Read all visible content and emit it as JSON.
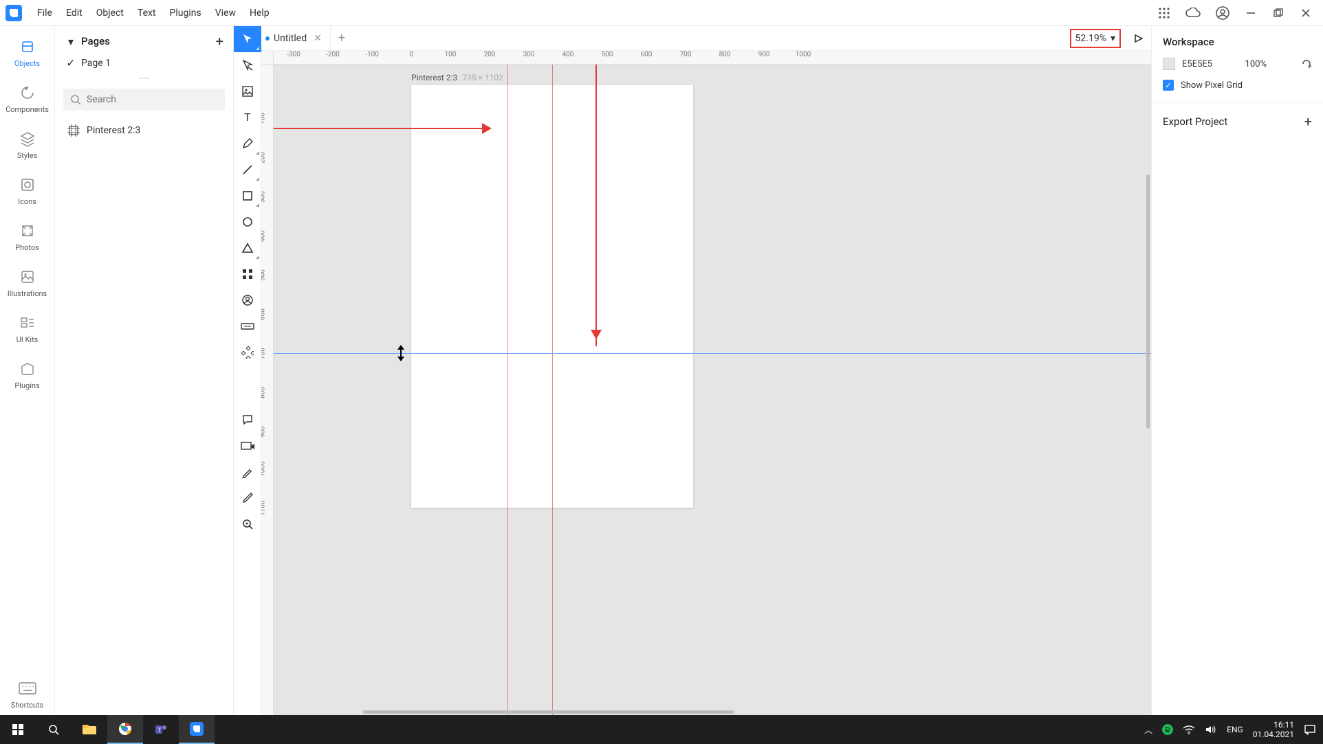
{
  "menu": {
    "items": [
      "File",
      "Edit",
      "Object",
      "Text",
      "Plugins",
      "View",
      "Help"
    ]
  },
  "rail": {
    "items": [
      "Objects",
      "Components",
      "Styles",
      "Icons",
      "Photos",
      "Illustrations",
      "UI Kits",
      "Plugins",
      "Shortcuts"
    ]
  },
  "pages": {
    "header": "Pages",
    "page1": "Page 1"
  },
  "search": {
    "placeholder": "Search"
  },
  "layers": {
    "item1": "Pinterest 2:3"
  },
  "tab": {
    "title": "Untitled"
  },
  "zoom": {
    "value": "52.19%"
  },
  "artboard": {
    "name": "Pinterest 2:3",
    "dims": "735 × 1102"
  },
  "ruler_h": {
    "ticks": [
      "-300",
      "-200",
      "-100",
      "0",
      "100",
      "200",
      "300",
      "400",
      "500",
      "600",
      "700",
      "800",
      "900",
      "1000"
    ]
  },
  "ruler_v": {
    "ticks": [
      "100",
      "200",
      "300",
      "400",
      "500",
      "600",
      "700",
      "800",
      "900",
      "1000",
      "1100"
    ]
  },
  "workspace": {
    "title": "Workspace",
    "bg_hex": "E5E5E5",
    "bg_opacity": "100%",
    "pixel_grid": "Show Pixel Grid",
    "export": "Export Project"
  },
  "tray": {
    "lang": "ENG",
    "time": "16:11",
    "date": "01.04.2021"
  }
}
